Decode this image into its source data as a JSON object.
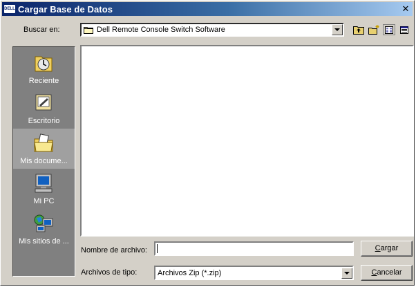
{
  "window": {
    "title": "Cargar Base de Datos",
    "logo_text": "DELL",
    "close_glyph": "✕"
  },
  "look_in": {
    "label": "Buscar en:",
    "current_folder": "Dell Remote Console Switch Software"
  },
  "toolbar": {
    "buttons": [
      "up-one-level-icon",
      "new-folder-icon",
      "list-view-icon",
      "details-view-icon"
    ]
  },
  "places": [
    {
      "label": "Reciente",
      "icon": "recent-clock-icon",
      "selected": false
    },
    {
      "label": "Escritorio",
      "icon": "desktop-icon",
      "selected": false
    },
    {
      "label": "Mis docume...",
      "icon": "my-documents-folder-icon",
      "selected": true
    },
    {
      "label": "Mi PC",
      "icon": "my-computer-icon",
      "selected": false
    },
    {
      "label": "Mis sitios de ...",
      "icon": "network-places-icon",
      "selected": false
    }
  ],
  "file_name": {
    "label": "Nombre de archivo:",
    "value": ""
  },
  "file_type": {
    "label": "Archivos de tipo:",
    "selected": "Archivos Zip (*.zip)"
  },
  "buttons": {
    "load_prefix": "",
    "load_underlined": "C",
    "load_rest": "argar",
    "cancel_prefix": "",
    "cancel_underlined": "C",
    "cancel_rest": "ancelar"
  },
  "colors": {
    "title_start": "#0a246a",
    "title_end": "#a6caf0",
    "face": "#d4d0c8",
    "places_bar": "#808080"
  }
}
